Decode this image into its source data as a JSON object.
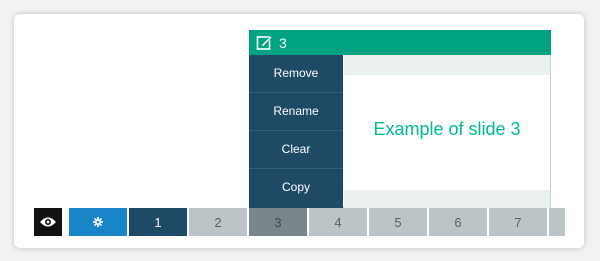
{
  "popup": {
    "title_number": "3",
    "menu_items": [
      "Remove",
      "Rename",
      "Clear",
      "Copy"
    ],
    "preview_text": "Example of slide 3"
  },
  "toolbar": {
    "view_icon": "eye-icon",
    "settings_icon": "gear-icon",
    "slides": [
      "1",
      "2",
      "3",
      "4",
      "5",
      "6",
      "7"
    ],
    "current_slide": "3"
  },
  "colors": {
    "accent_green": "#00a381",
    "menu_navy": "#1e4a66",
    "settings_blue": "#1a84c9",
    "preview_text": "#00b894"
  }
}
